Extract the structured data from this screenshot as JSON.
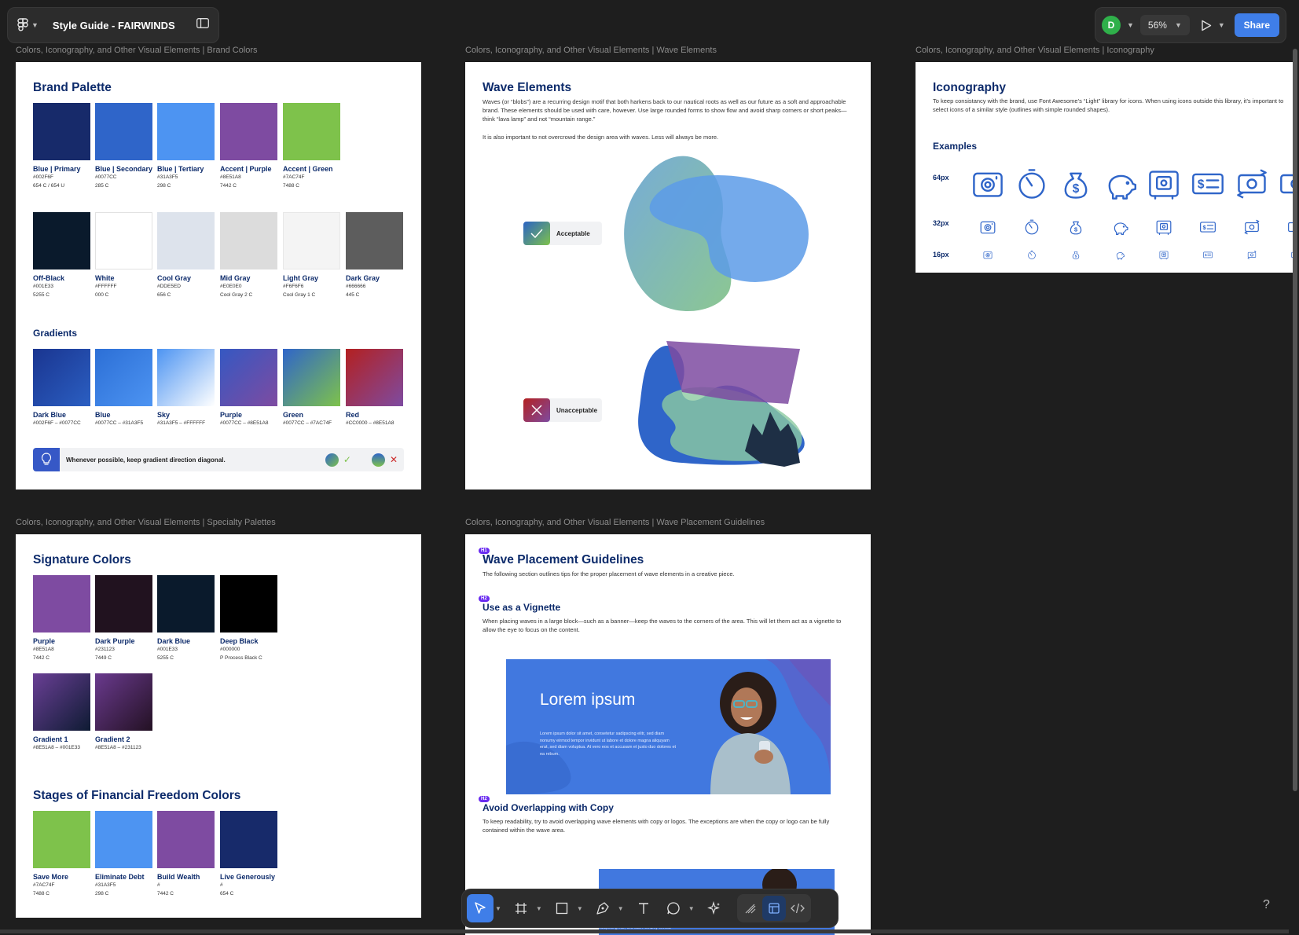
{
  "topbar": {
    "file_title": "Style Guide - FAIRWINDS",
    "avatar_initial": "D",
    "zoom": "56%",
    "share_label": "Share"
  },
  "frames": {
    "brand_colors": {
      "label": "Colors, Iconography, and Other Visual Elements | Brand Colors",
      "palette_title": "Brand Palette",
      "primary": [
        {
          "name": "Blue | Primary",
          "hex": "#002F6F",
          "pms": "654 C / 654 U",
          "color": "#172a6a"
        },
        {
          "name": "Blue | Secondary",
          "hex": "#0077CC",
          "pms": "285 C",
          "color": "#2f65c9"
        },
        {
          "name": "Blue | Tertiary",
          "hex": "#31A3F5",
          "pms": "298 C",
          "color": "#4d94f2"
        },
        {
          "name": "Accent | Purple",
          "hex": "#8E51A8",
          "pms": "7442 C",
          "color": "#7e4ba1"
        },
        {
          "name": "Accent | Green",
          "hex": "#7AC74F",
          "pms": "7488 C",
          "color": "#7ec24b"
        }
      ],
      "neutrals": [
        {
          "name": "Off-Black",
          "hex": "#001E33",
          "pms": "5255 C",
          "color": "#0a1a2c"
        },
        {
          "name": "White",
          "hex": "#FFFFFF",
          "pms": "000 C",
          "color": "#ffffff"
        },
        {
          "name": "Cool Gray",
          "hex": "#DDE5ED",
          "pms": "656 C",
          "color": "#dde3ec"
        },
        {
          "name": "Mid Gray",
          "hex": "#E0E0E0",
          "pms": "Cool Gray 2 C",
          "color": "#dcdcdc"
        },
        {
          "name": "Light Gray",
          "hex": "#F6F6F6",
          "pms": "Cool Gray 1 C",
          "color": "#f4f4f4"
        },
        {
          "name": "Dark Gray",
          "hex": "#666666",
          "pms": "445 C",
          "color": "#5d5d5d"
        }
      ],
      "gradients_title": "Gradients",
      "gradients": [
        {
          "name": "Dark Blue",
          "hex": "#002F6F – #0077CC",
          "from": "#1a3590",
          "to": "#2b5fc2"
        },
        {
          "name": "Blue",
          "hex": "#0077CC – #31A3F5",
          "from": "#2c6fd6",
          "to": "#4d94f2"
        },
        {
          "name": "Sky",
          "hex": "#31A3F5 – #FFFFFF",
          "from": "#4d94f2",
          "to": "#ffffff"
        },
        {
          "name": "Purple",
          "hex": "#0077CC – #8E51A8",
          "from": "#3558c2",
          "to": "#7e4ba1"
        },
        {
          "name": "Green",
          "hex": "#0077CC – #7AC74F",
          "from": "#2f65c9",
          "to": "#7ec24b"
        },
        {
          "name": "Red",
          "hex": "#CC0000 – #8E51A8",
          "from": "#b32020",
          "to": "#7e4ba1"
        }
      ],
      "tip": "Whenever possible, keep gradient direction diagonal."
    },
    "wave_elements": {
      "label": "Colors, Iconography, and Other Visual Elements | Wave Elements",
      "title": "Wave Elements",
      "para1": "Waves (or “blobs”) are a recurring design motif that both harkens back to our nautical roots as well as our future as a soft and approachable brand. These elements should be used with care, however. Use large rounded forms to show flow and avoid sharp corners or short peaks—think “lava lamp” and not “mountain range.”",
      "para2": "It is also important to not overcrowd the design area with waves.  Less will always be more.",
      "acceptable": "Acceptable",
      "unacceptable": "Unacceptable"
    },
    "iconography": {
      "label": "Colors, Iconography, and Other Visual Elements | Iconography",
      "title": "Iconography",
      "para": "To keep consistancy with the brand, use Font Awesome’s “Light” library for icons. When using icons outside this library, it’s important to select icons of a similar style (outlines with simple rounded shapes).",
      "examples": "Examples",
      "sizes": [
        "64px",
        "32px",
        "16px"
      ],
      "icon_names": [
        "vault-icon",
        "stopwatch-icon",
        "money-bag-icon",
        "piggy-bank-icon",
        "cash-register-icon",
        "money-check-icon",
        "money-transfer-icon",
        "money-bill-icon"
      ]
    },
    "specialty": {
      "label": "Colors, Iconography, and Other Visual Elements | Specialty Palettes",
      "signature_title": "Signature Colors",
      "signature": [
        {
          "name": "Purple",
          "hex": "#8E51A8",
          "pms": "7442 C",
          "color": "#7e4ba1"
        },
        {
          "name": "Dark Purple",
          "hex": "#231123",
          "pms": "7449 C",
          "color": "#21121f"
        },
        {
          "name": "Dark Blue",
          "hex": "#001E33",
          "pms": "5255 C",
          "color": "#0a1a2c"
        },
        {
          "name": "Deep Black",
          "hex": "#000000",
          "pms": "P Process Black C",
          "color": "#000000"
        }
      ],
      "signature_gradients": [
        {
          "name": "Gradient 1",
          "hex": "#8E51A8 – #001E33",
          "from": "#6a3f95",
          "to": "#0e1b33"
        },
        {
          "name": "Gradient 2",
          "hex": "#8E51A8 – #231123",
          "from": "#6a3a8e",
          "to": "#231123"
        }
      ],
      "stages_title": "Stages of Financial Freedom Colors",
      "stages": [
        {
          "name": "Save More",
          "hex": "#7AC74F",
          "pms": "7488 C",
          "color": "#7ec24b"
        },
        {
          "name": "Eliminate Debt",
          "hex": "#31A3F5",
          "pms": "298 C",
          "color": "#4d94f2"
        },
        {
          "name": "Build Wealth",
          "hex": "#",
          "pms": "7442 C",
          "color": "#7e4ba1"
        },
        {
          "name": "Live Generously",
          "hex": "#",
          "pms": "654 C",
          "color": "#172a6a"
        }
      ]
    },
    "placement": {
      "label": "Colors, Iconography, and Other Visual Elements | Wave Placement Guidelines",
      "h1_badge": "H1",
      "title": "Wave Placement Guidelines",
      "intro": "The following section outlines tips for the proper placement of wave elements in a creative piece.",
      "h2_badge": "H2",
      "vignette_title": "Use as a Vignette",
      "vignette_text": "When placing waves in a large block—such as a banner—keep the waves to the corners of the area.  This will let them act as a vignette to allow the eye to focus on the content.",
      "banner_heading": "Lorem ipsum",
      "banner_body": "Lorem ipsum dolor sit amet, consetetur sadipscing elitr, sed diam nonumy eirmod tempor invidunt ut labore et dolore magna aliquyam erat, sed diam voluptua. At vero eos et accusam et justo duo dolores et ea rebum.",
      "overlap_title": "Avoid Overlapping with Copy",
      "overlap_text": "To keep readability, try to avoid overlapping wave elements with copy or logos. The exceptions are when the copy or logo can be fully contained within the wave area.",
      "banner2_fragment": "sadipscing elitr, sed diam nonumy eirmod"
    }
  },
  "toolbar": {
    "tools": [
      "move-tool",
      "frame-tool",
      "rectangle-tool",
      "pen-tool",
      "text-tool",
      "comment-tool",
      "actions-tool"
    ],
    "modes": [
      "draw-mode",
      "design-mode",
      "dev-mode"
    ]
  },
  "help_label": "?"
}
